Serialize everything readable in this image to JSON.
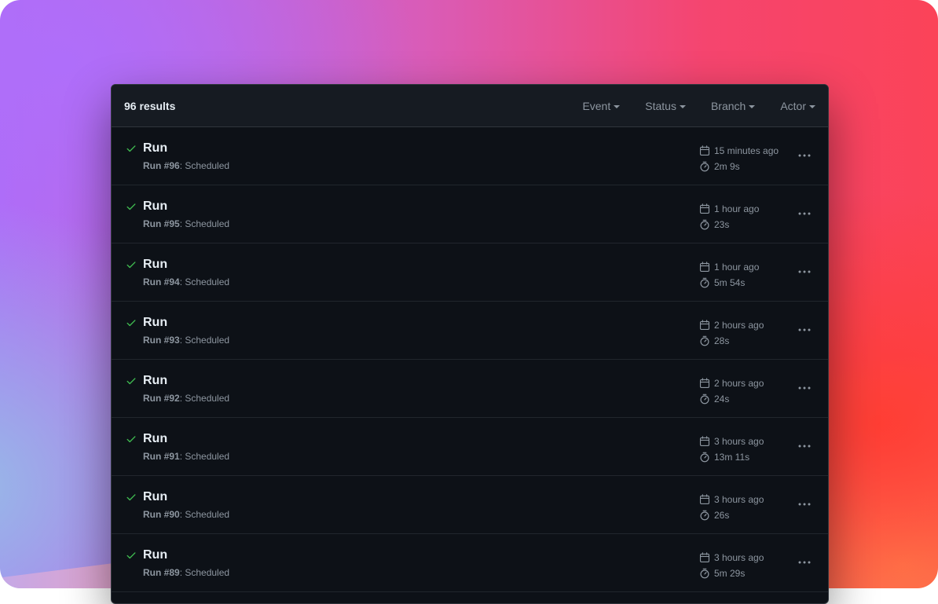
{
  "header": {
    "results_label": "96 results",
    "filters": [
      {
        "label": "Event"
      },
      {
        "label": "Status"
      },
      {
        "label": "Branch"
      },
      {
        "label": "Actor"
      }
    ]
  },
  "runs": [
    {
      "title": "Run",
      "run_number": "Run #96",
      "trigger": ": Scheduled",
      "time_ago": "15 minutes ago",
      "duration": "2m 9s",
      "status": "success"
    },
    {
      "title": "Run",
      "run_number": "Run #95",
      "trigger": ": Scheduled",
      "time_ago": "1 hour ago",
      "duration": "23s",
      "status": "success"
    },
    {
      "title": "Run",
      "run_number": "Run #94",
      "trigger": ": Scheduled",
      "time_ago": "1 hour ago",
      "duration": "5m 54s",
      "status": "success"
    },
    {
      "title": "Run",
      "run_number": "Run #93",
      "trigger": ": Scheduled",
      "time_ago": "2 hours ago",
      "duration": "28s",
      "status": "success"
    },
    {
      "title": "Run",
      "run_number": "Run #92",
      "trigger": ": Scheduled",
      "time_ago": "2 hours ago",
      "duration": "24s",
      "status": "success"
    },
    {
      "title": "Run",
      "run_number": "Run #91",
      "trigger": ": Scheduled",
      "time_ago": "3 hours ago",
      "duration": "13m 11s",
      "status": "success"
    },
    {
      "title": "Run",
      "run_number": "Run #90",
      "trigger": ": Scheduled",
      "time_ago": "3 hours ago",
      "duration": "26s",
      "status": "success"
    },
    {
      "title": "Run",
      "run_number": "Run #89",
      "trigger": ": Scheduled",
      "time_ago": "3 hours ago",
      "duration": "5m 29s",
      "status": "success"
    }
  ],
  "icons": {
    "status": "check-icon",
    "time": "calendar-icon",
    "duration": "stopwatch-icon",
    "more": "kebab-horizontal-icon"
  },
  "colors": {
    "success": "#3fb950",
    "panel_bg": "#0d1117",
    "header_bg": "#161b22",
    "border": "#30363d",
    "text_primary": "#e6edf3",
    "text_muted": "#8d96a0"
  }
}
